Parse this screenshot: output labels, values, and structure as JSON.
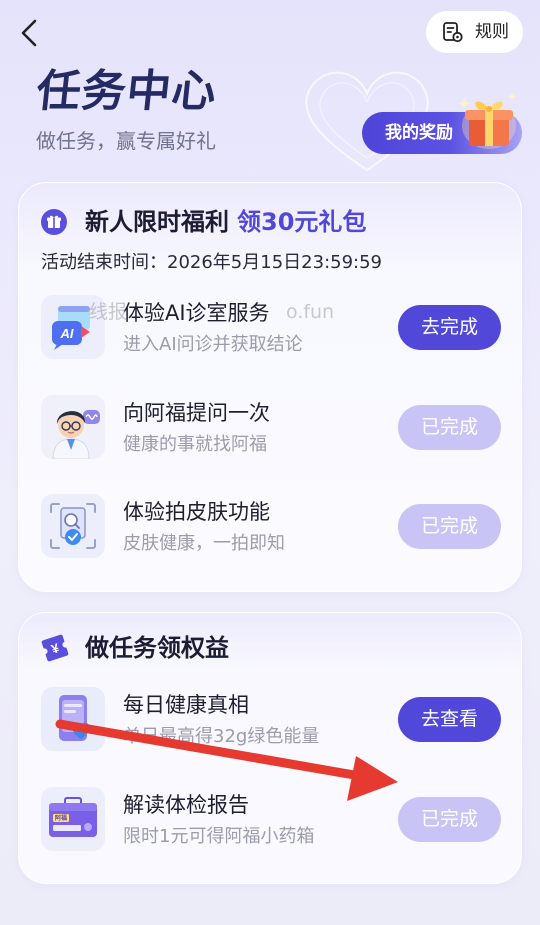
{
  "header": {
    "back_icon": "chevron-left-icon",
    "rules_icon": "document-gear-icon",
    "rules_label": "规则",
    "title": "任务中心",
    "subtitle": "做任务，赢专属好礼",
    "rewards_label": "我的奖励",
    "rewards_icon": "gift-box-icon"
  },
  "newcomer": {
    "icon": "gift-icon",
    "title": "新人限时福利",
    "highlight": "领30元礼包",
    "deadline": "活动结束时间：2026年5月15日23:59:59",
    "tasks": [
      {
        "icon": "ai-clinic-icon",
        "icon_text": "AI",
        "title": "体验AI诊室服务",
        "desc": "进入AI问诊并获取结论",
        "button": "去完成",
        "completed": false
      },
      {
        "icon": "doctor-avatar-icon",
        "title": "向阿福提问一次",
        "desc": "健康的事就找阿福",
        "button": "已完成",
        "completed": true
      },
      {
        "icon": "skin-scan-icon",
        "title": "体验拍皮肤功能",
        "desc": "皮肤健康，一拍即知",
        "button": "已完成",
        "completed": true
      }
    ]
  },
  "benefits": {
    "icon": "yuan-ticket-icon",
    "icon_text": "¥",
    "title": "做任务领权益",
    "tasks": [
      {
        "icon": "phone-heart-icon",
        "title": "每日健康真相",
        "desc": "单日最高得32g绿色能量",
        "button": "去查看",
        "completed": false
      },
      {
        "icon": "medicine-box-icon",
        "icon_text": "阿福",
        "title": "解读体检报告",
        "desc": "限时1元可得阿福小药箱",
        "button": "已完成",
        "completed": true
      }
    ]
  },
  "watermark": [
    "线报",
    "o.fun"
  ],
  "annotation": {
    "icon": "red-arrow-icon"
  },
  "colors": {
    "accent": "#5148d9",
    "completed": "#c8c4f5",
    "title": "#262a63",
    "highlight": "#5148d9",
    "arrow": "#e6392f"
  }
}
